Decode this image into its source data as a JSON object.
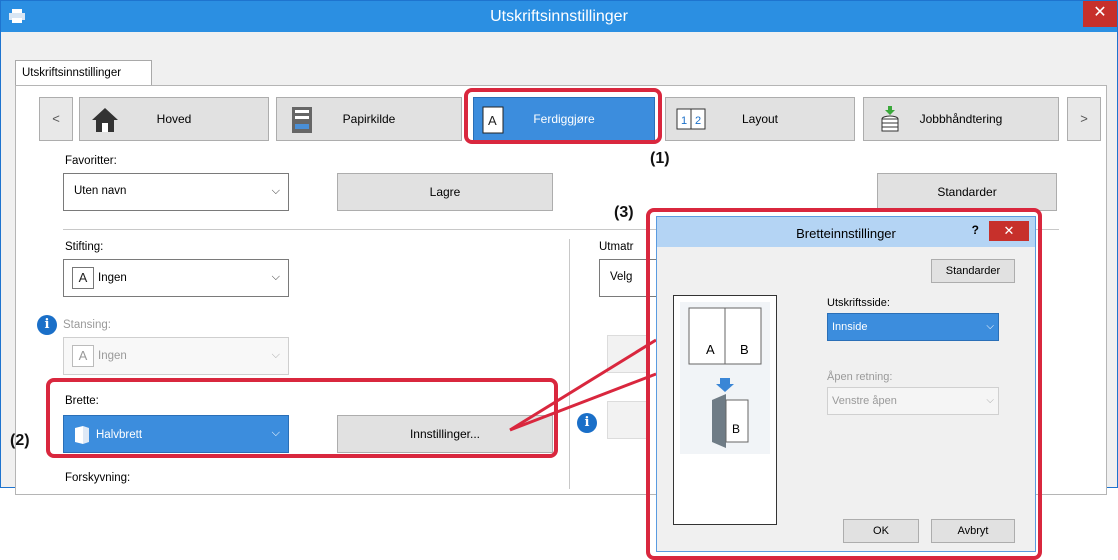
{
  "window": {
    "title": "Utskriftsinnstillinger",
    "close_glyph": "✕",
    "outer_tab": "Utskriftsinnstillinger"
  },
  "nav": {
    "prev": "<",
    "next": ">",
    "tabs": [
      {
        "label": "Hoved",
        "icon": "home-icon"
      },
      {
        "label": "Papirkilde",
        "icon": "paper-tray-icon"
      },
      {
        "label": "Ferdiggjøre",
        "icon": "finishing-icon",
        "selected": true
      },
      {
        "label": "Layout",
        "icon": "layout-icon"
      },
      {
        "label": "Jobbhåndtering",
        "icon": "job-handling-icon"
      }
    ]
  },
  "favorites": {
    "label": "Favoritter:",
    "value": "Uten navn",
    "save_button": "Lagre",
    "defaults_button": "Standarder"
  },
  "stapling": {
    "label": "Stifting:",
    "value": "Ingen"
  },
  "output": {
    "label": "Utmatr",
    "value": "Velg"
  },
  "punching": {
    "label": "Stansing:",
    "value": "Ingen"
  },
  "fold": {
    "label": "Brette:",
    "value": "Halvbrett",
    "settings_button": "Innstillinger..."
  },
  "offset": {
    "label": "Forskyvning:"
  },
  "markers": {
    "one": "(1)",
    "two": "(2)",
    "three": "(3)"
  },
  "fold_dialog": {
    "title": "Bretteinnstillinger",
    "help": "?",
    "close_glyph": "✕",
    "defaults_button": "Standarder",
    "print_side_label": "Utskriftsside:",
    "print_side_value": "Innside",
    "open_direction_label": "Åpen retning:",
    "open_direction_value": "Venstre åpen",
    "preview_a": "A",
    "preview_b": "B",
    "ok_button": "OK",
    "cancel_button": "Avbryt"
  },
  "colors": {
    "titlebar": "#2b8fe2",
    "selected": "#3c8ddd",
    "callout": "#d9273e",
    "close": "#c7302b"
  }
}
